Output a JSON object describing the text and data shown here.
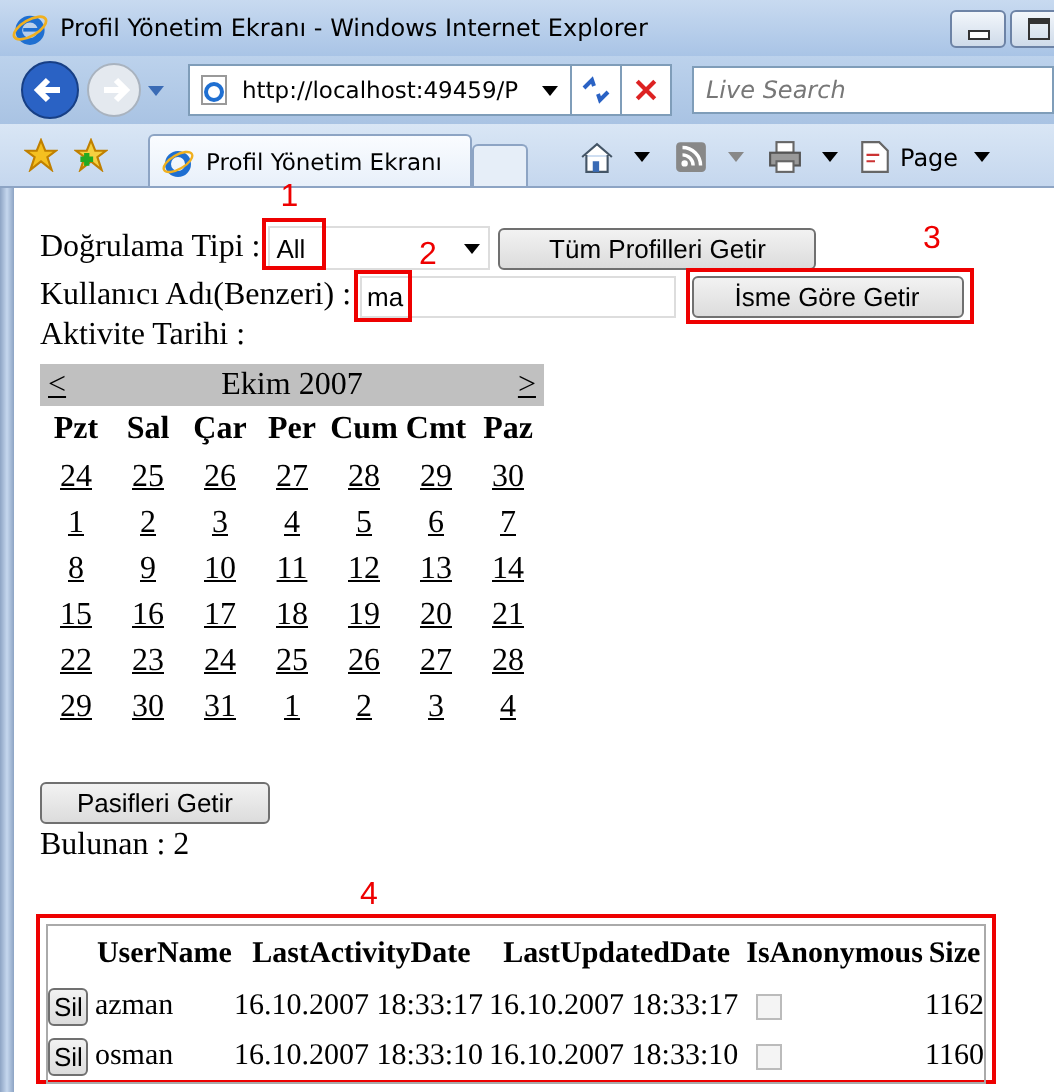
{
  "window": {
    "title": "Profil Yönetim Ekranı - Windows Internet Explorer"
  },
  "address_bar": {
    "url": "http://localhost:49459/P"
  },
  "search": {
    "placeholder": "Live Search"
  },
  "tabs": [
    {
      "label": "Profil Yönetim Ekranı",
      "selected": true
    }
  ],
  "command_bar": {
    "page_menu": "Page"
  },
  "form": {
    "auth_type": {
      "label": "Doğrulama Tipi :",
      "value": "All",
      "annotation": "1"
    },
    "all_button": "Tüm Profilleri Getir",
    "username": {
      "label": "Kullanıcı Adı(Benzeri) :",
      "value": "ma",
      "annotation": "2"
    },
    "name_button": {
      "label": "İsme Göre Getir",
      "annotation": "3"
    },
    "date_label": "Aktivite Tarihi :"
  },
  "calendar": {
    "prev": "<",
    "title": "Ekim 2007",
    "next": ">",
    "weekdays": [
      "Pzt",
      "Sal",
      "Çar",
      "Per",
      "Cum",
      "Cmt",
      "Paz"
    ],
    "weeks": [
      [
        "24",
        "25",
        "26",
        "27",
        "28",
        "29",
        "30"
      ],
      [
        "1",
        "2",
        "3",
        "4",
        "5",
        "6",
        "7"
      ],
      [
        "8",
        "9",
        "10",
        "11",
        "12",
        "13",
        "14"
      ],
      [
        "15",
        "16",
        "17",
        "18",
        "19",
        "20",
        "21"
      ],
      [
        "22",
        "23",
        "24",
        "25",
        "26",
        "27",
        "28"
      ],
      [
        "29",
        "30",
        "31",
        "1",
        "2",
        "3",
        "4"
      ]
    ]
  },
  "inactive_button": "Pasifleri Getir",
  "found": "Bulunan : 2",
  "table": {
    "annotation": "4",
    "columns": [
      "UserName",
      "LastActivityDate",
      "LastUpdatedDate",
      "IsAnonymous",
      "Size"
    ],
    "rows": [
      {
        "action": "Sil",
        "username": "azman",
        "last_activity": "16.10.2007 18:33:17",
        "last_updated": "16.10.2007 18:33:17",
        "is_anonymous": false,
        "size": "1162"
      },
      {
        "action": "Sil",
        "username": "osman",
        "last_activity": "16.10.2007 18:33:10",
        "last_updated": "16.10.2007 18:33:10",
        "is_anonymous": false,
        "size": "1160"
      }
    ]
  }
}
